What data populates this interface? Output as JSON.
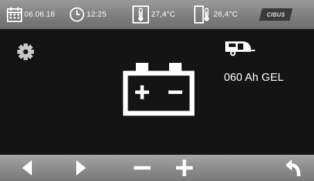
{
  "status_bar": {
    "date": "06.06.16",
    "time": "12:25",
    "indoor_temp": "27,4°C",
    "outdoor_temp": "26,4°C",
    "brand": "CIBUS",
    "icons": [
      "calendar-icon",
      "clock-icon",
      "thermometer-indoor-icon",
      "thermometer-outdoor-icon"
    ]
  },
  "main": {
    "settings_icon": "gear-icon",
    "battery_icon": "battery-icon",
    "vehicle_icon": "caravan-icon",
    "battery_capacity": "060 Ah GEL"
  },
  "toolbar": {
    "buttons": [
      "arrow-left-icon",
      "arrow-right-icon",
      "minus-icon",
      "plus-icon",
      "back-icon"
    ]
  },
  "colors": {
    "background": "#141414",
    "bar": "#8d8d8d",
    "foreground": "#ffffff"
  }
}
